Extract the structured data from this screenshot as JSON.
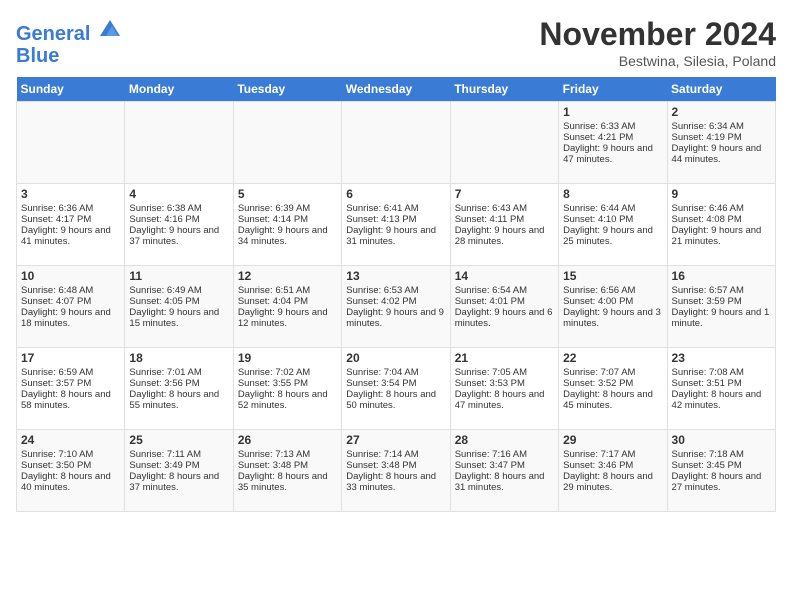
{
  "header": {
    "logo_line1": "General",
    "logo_line2": "Blue",
    "month": "November 2024",
    "location": "Bestwina, Silesia, Poland"
  },
  "weekdays": [
    "Sunday",
    "Monday",
    "Tuesday",
    "Wednesday",
    "Thursday",
    "Friday",
    "Saturday"
  ],
  "weeks": [
    [
      {
        "day": "",
        "info": ""
      },
      {
        "day": "",
        "info": ""
      },
      {
        "day": "",
        "info": ""
      },
      {
        "day": "",
        "info": ""
      },
      {
        "day": "",
        "info": ""
      },
      {
        "day": "1",
        "info": "Sunrise: 6:33 AM\nSunset: 4:21 PM\nDaylight: 9 hours and 47 minutes."
      },
      {
        "day": "2",
        "info": "Sunrise: 6:34 AM\nSunset: 4:19 PM\nDaylight: 9 hours and 44 minutes."
      }
    ],
    [
      {
        "day": "3",
        "info": "Sunrise: 6:36 AM\nSunset: 4:17 PM\nDaylight: 9 hours and 41 minutes."
      },
      {
        "day": "4",
        "info": "Sunrise: 6:38 AM\nSunset: 4:16 PM\nDaylight: 9 hours and 37 minutes."
      },
      {
        "day": "5",
        "info": "Sunrise: 6:39 AM\nSunset: 4:14 PM\nDaylight: 9 hours and 34 minutes."
      },
      {
        "day": "6",
        "info": "Sunrise: 6:41 AM\nSunset: 4:13 PM\nDaylight: 9 hours and 31 minutes."
      },
      {
        "day": "7",
        "info": "Sunrise: 6:43 AM\nSunset: 4:11 PM\nDaylight: 9 hours and 28 minutes."
      },
      {
        "day": "8",
        "info": "Sunrise: 6:44 AM\nSunset: 4:10 PM\nDaylight: 9 hours and 25 minutes."
      },
      {
        "day": "9",
        "info": "Sunrise: 6:46 AM\nSunset: 4:08 PM\nDaylight: 9 hours and 21 minutes."
      }
    ],
    [
      {
        "day": "10",
        "info": "Sunrise: 6:48 AM\nSunset: 4:07 PM\nDaylight: 9 hours and 18 minutes."
      },
      {
        "day": "11",
        "info": "Sunrise: 6:49 AM\nSunset: 4:05 PM\nDaylight: 9 hours and 15 minutes."
      },
      {
        "day": "12",
        "info": "Sunrise: 6:51 AM\nSunset: 4:04 PM\nDaylight: 9 hours and 12 minutes."
      },
      {
        "day": "13",
        "info": "Sunrise: 6:53 AM\nSunset: 4:02 PM\nDaylight: 9 hours and 9 minutes."
      },
      {
        "day": "14",
        "info": "Sunrise: 6:54 AM\nSunset: 4:01 PM\nDaylight: 9 hours and 6 minutes."
      },
      {
        "day": "15",
        "info": "Sunrise: 6:56 AM\nSunset: 4:00 PM\nDaylight: 9 hours and 3 minutes."
      },
      {
        "day": "16",
        "info": "Sunrise: 6:57 AM\nSunset: 3:59 PM\nDaylight: 9 hours and 1 minute."
      }
    ],
    [
      {
        "day": "17",
        "info": "Sunrise: 6:59 AM\nSunset: 3:57 PM\nDaylight: 8 hours and 58 minutes."
      },
      {
        "day": "18",
        "info": "Sunrise: 7:01 AM\nSunset: 3:56 PM\nDaylight: 8 hours and 55 minutes."
      },
      {
        "day": "19",
        "info": "Sunrise: 7:02 AM\nSunset: 3:55 PM\nDaylight: 8 hours and 52 minutes."
      },
      {
        "day": "20",
        "info": "Sunrise: 7:04 AM\nSunset: 3:54 PM\nDaylight: 8 hours and 50 minutes."
      },
      {
        "day": "21",
        "info": "Sunrise: 7:05 AM\nSunset: 3:53 PM\nDaylight: 8 hours and 47 minutes."
      },
      {
        "day": "22",
        "info": "Sunrise: 7:07 AM\nSunset: 3:52 PM\nDaylight: 8 hours and 45 minutes."
      },
      {
        "day": "23",
        "info": "Sunrise: 7:08 AM\nSunset: 3:51 PM\nDaylight: 8 hours and 42 minutes."
      }
    ],
    [
      {
        "day": "24",
        "info": "Sunrise: 7:10 AM\nSunset: 3:50 PM\nDaylight: 8 hours and 40 minutes."
      },
      {
        "day": "25",
        "info": "Sunrise: 7:11 AM\nSunset: 3:49 PM\nDaylight: 8 hours and 37 minutes."
      },
      {
        "day": "26",
        "info": "Sunrise: 7:13 AM\nSunset: 3:48 PM\nDaylight: 8 hours and 35 minutes."
      },
      {
        "day": "27",
        "info": "Sunrise: 7:14 AM\nSunset: 3:48 PM\nDaylight: 8 hours and 33 minutes."
      },
      {
        "day": "28",
        "info": "Sunrise: 7:16 AM\nSunset: 3:47 PM\nDaylight: 8 hours and 31 minutes."
      },
      {
        "day": "29",
        "info": "Sunrise: 7:17 AM\nSunset: 3:46 PM\nDaylight: 8 hours and 29 minutes."
      },
      {
        "day": "30",
        "info": "Sunrise: 7:18 AM\nSunset: 3:45 PM\nDaylight: 8 hours and 27 minutes."
      }
    ]
  ]
}
